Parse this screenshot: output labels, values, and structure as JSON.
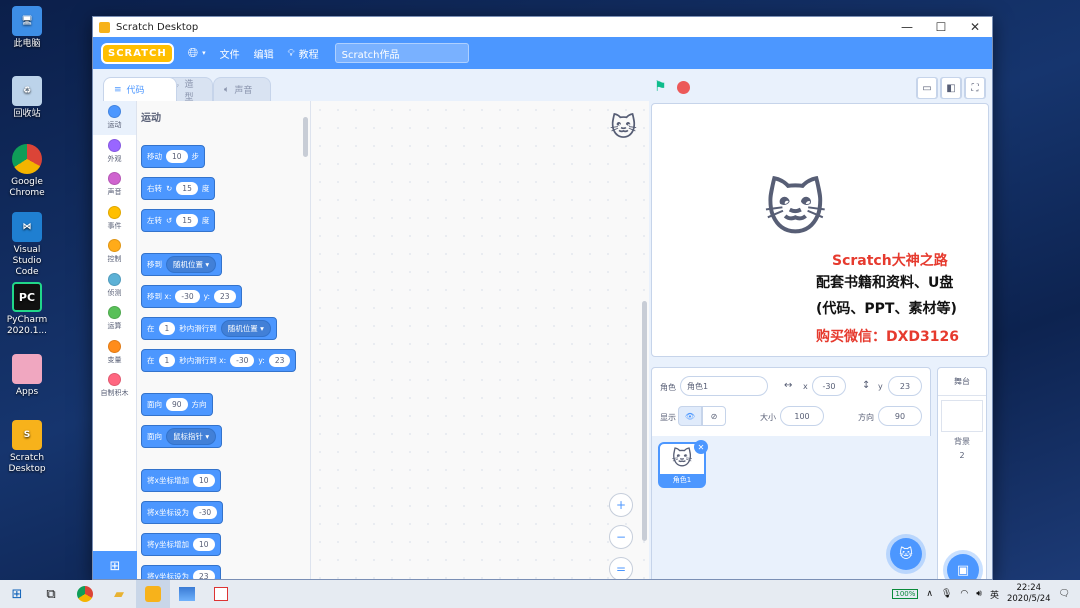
{
  "desktop": {
    "icons": [
      "此电脑",
      "回收站",
      "Google Chrome",
      "Visual Studio Code",
      "PyCharm 2020.1...",
      "Apps",
      "Scratch Desktop"
    ]
  },
  "window": {
    "title": "Scratch Desktop",
    "controls": [
      "—",
      "☐",
      "✕"
    ]
  },
  "menubar": {
    "logo": "SCRATCH",
    "file": "文件",
    "edit": "编辑",
    "tutorials": "教程",
    "project_title": "Scratch作品"
  },
  "tabs": {
    "code": "代码",
    "costumes": "造型",
    "sounds": "声音"
  },
  "categories": [
    {
      "label": "运动",
      "color": "#4c97ff"
    },
    {
      "label": "外观",
      "color": "#9966ff"
    },
    {
      "label": "声音",
      "color": "#cf63cf"
    },
    {
      "label": "事件",
      "color": "#ffbf00"
    },
    {
      "label": "控制",
      "color": "#ffab19"
    },
    {
      "label": "侦测",
      "color": "#5cb1d6"
    },
    {
      "label": "运算",
      "color": "#59c059"
    },
    {
      "label": "变量",
      "color": "#ff8c1a"
    },
    {
      "label": "自制积木",
      "color": "#ff6680"
    }
  ],
  "palette": {
    "title": "运动",
    "move": {
      "a": "移动",
      "v": "10",
      "b": "步"
    },
    "turn_right": {
      "a": "右转",
      "v": "15",
      "b": "度"
    },
    "turn_left": {
      "a": "左转",
      "v": "15",
      "b": "度"
    },
    "goto": {
      "a": "移到",
      "d": "随机位置"
    },
    "goto_xy": {
      "a": "移到 x:",
      "x": "-30",
      "y_lbl": "y:",
      "y": "23"
    },
    "glide": {
      "a": "在",
      "v": "1",
      "b": "秒内滑行到",
      "d": "随机位置"
    },
    "glide_xy": {
      "a": "在",
      "v": "1",
      "b": "秒内滑行到 x:",
      "x": "-30",
      "y_lbl": "y:",
      "y": "23"
    },
    "point_dir": {
      "a": "面向",
      "v": "90",
      "b": "方向"
    },
    "point_towards": {
      "a": "面向",
      "d": "鼠标指针"
    },
    "change_x": {
      "a": "将x坐标增加",
      "v": "10"
    },
    "set_x": {
      "a": "将x坐标设为",
      "v": "-30"
    },
    "change_y": {
      "a": "将y坐标增加",
      "v": "10"
    },
    "set_y": {
      "a": "将y坐标设为",
      "v": "23"
    }
  },
  "stage": {
    "overlay": [
      "Scratch大神之路",
      "配套书籍和资料、U盘",
      "(代码、PPT、素材等)",
      "购买微信：DXD3126"
    ]
  },
  "sprite_info": {
    "sprite_label": "角色",
    "sprite_name": "角色1",
    "x_label": "x",
    "x": "-30",
    "y_label": "y",
    "y": "23",
    "show_label": "显示",
    "size_label": "大小",
    "size": "100",
    "direction_label": "方向",
    "direction": "90",
    "thumb_name": "角色1"
  },
  "stage_panel": {
    "title": "舞台",
    "backdrops_label": "背景",
    "backdrops_count": "2"
  },
  "taskbar": {
    "battery": "100%",
    "ime": "英",
    "time": "22:24",
    "date": "2020/5/24"
  }
}
